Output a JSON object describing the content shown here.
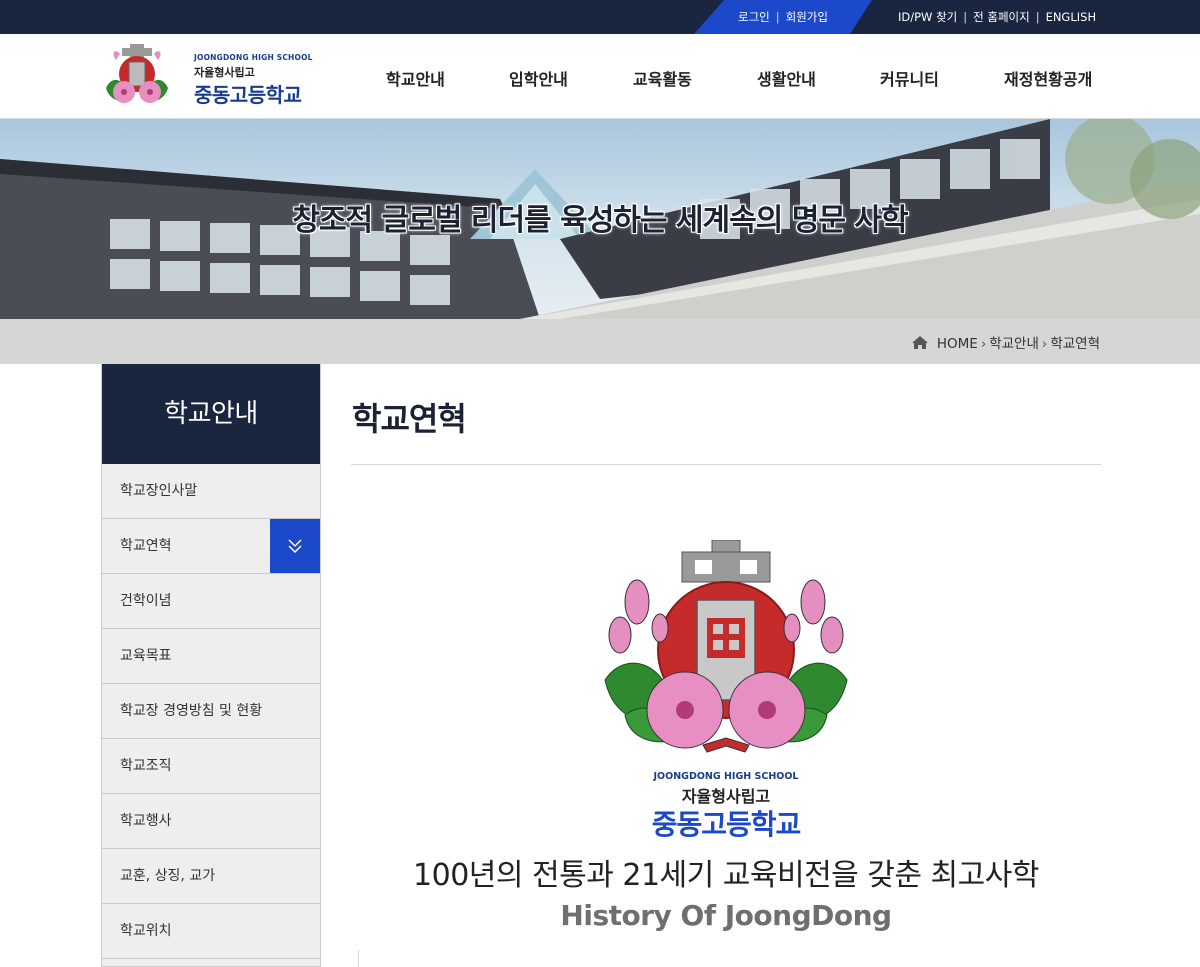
{
  "topbar": {
    "login": "로그인",
    "join": "회원가입",
    "find": "ID/PW 찾기",
    "home": "전 홈페이지",
    "english": "ENGLISH"
  },
  "logo": {
    "en": "JOONGDONG HIGH SCHOOL",
    "sub": "자율형사립고",
    "name": "중동고등학교"
  },
  "gnb": [
    "학교안내",
    "입학안내",
    "교육활동",
    "생활안내",
    "커뮤니티",
    "재정현황공개"
  ],
  "banner": {
    "slogan": "창조적 글로벌 리더를 육성하는 세계속의 명문 사학"
  },
  "breadcrumb": {
    "home": "HOME",
    "level1": "학교안내",
    "level2": "학교연혁"
  },
  "side": {
    "title": "학교안내",
    "items": [
      "학교장인사말",
      "학교연혁",
      "건학이념",
      "교육목표",
      "학교장 경영방침 및 현황",
      "학교조직",
      "학교행사",
      "교훈, 상징, 교가",
      "학교위치"
    ],
    "active_index": 1
  },
  "content": {
    "title": "학교연혁",
    "logo_en": "JOONGDONG HIGH SCHOOL",
    "logo_sub": "자율형사립고",
    "logo_name": "중동고등학교",
    "motto": "100년의 전통과 21세기 교육비전을 갖춘 최고사학",
    "history": "History Of JoongDong"
  },
  "colors": {
    "navy": "#1a2540",
    "accent_blue": "#1b49c9",
    "crumb_bg": "#d6d6d6"
  }
}
